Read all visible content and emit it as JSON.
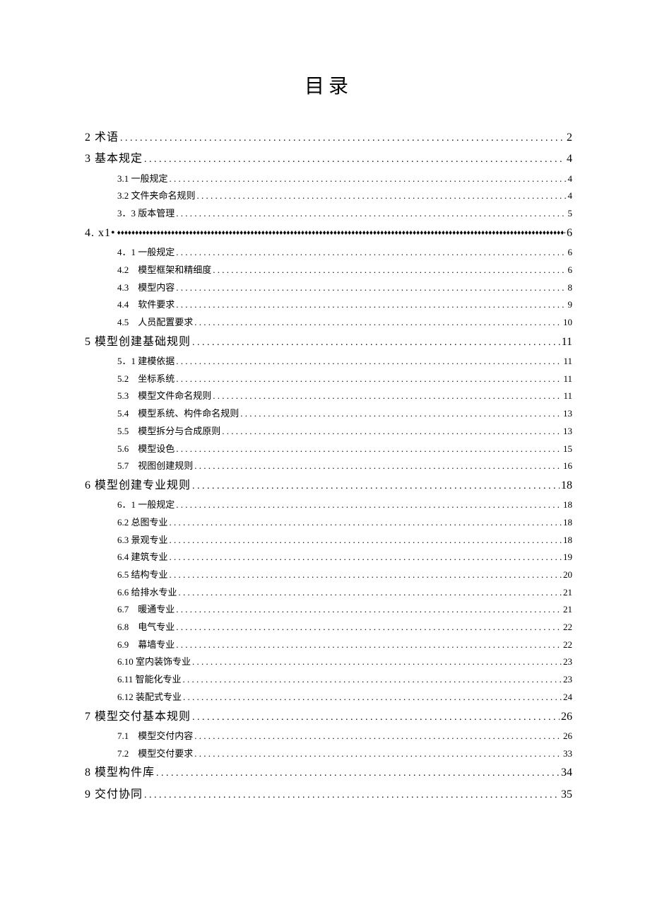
{
  "title": "目录",
  "toc": [
    {
      "level": 1,
      "label": "2 术语",
      "page": "2"
    },
    {
      "level": 1,
      "label": "3 基本规定",
      "page": "4"
    },
    {
      "level": 2,
      "label": "3.1 一般规定",
      "page": "4"
    },
    {
      "level": 2,
      "label": "3.2 文件夹命名规则",
      "page": "4"
    },
    {
      "level": 2,
      "label": "3．3 版本管理",
      "page": "5"
    },
    {
      "level": 1,
      "label": "4. x1•",
      "page": "6",
      "leader": "diamond"
    },
    {
      "level": 2,
      "label": "4．1 一般规定",
      "page": "6"
    },
    {
      "level": 2,
      "label": "4.2　模型框架和精细度",
      "page": "6"
    },
    {
      "level": 2,
      "label": "4.3　模型内容",
      "page": "8"
    },
    {
      "level": 2,
      "label": "4.4　软件要求",
      "page": "9"
    },
    {
      "level": 2,
      "label": "4.5　人员配置要求",
      "page": "10"
    },
    {
      "level": 1,
      "label": "5 模型创建基础规则",
      "page": "11"
    },
    {
      "level": 2,
      "label": "5．1 建模依据",
      "page": "11"
    },
    {
      "level": 2,
      "label": "5.2　坐标系统",
      "page": "11"
    },
    {
      "level": 2,
      "label": "5.3　模型文件命名规则",
      "page": "11"
    },
    {
      "level": 2,
      "label": "5.4　模型系统、构件命名规则",
      "page": "13"
    },
    {
      "level": 2,
      "label": "5.5　模型拆分与合成原则",
      "page": "13"
    },
    {
      "level": 2,
      "label": "5.6　模型设色",
      "page": "15"
    },
    {
      "level": 2,
      "label": "5.7　视图创建规则",
      "page": "16"
    },
    {
      "level": 1,
      "label": "6 模型创建专业规则",
      "page": "18"
    },
    {
      "level": 2,
      "label": "6．1 一般规定",
      "page": "18"
    },
    {
      "level": 2,
      "label": "6.2 总图专业",
      "page": "18"
    },
    {
      "level": 2,
      "label": "6.3 景观专业",
      "page": "18"
    },
    {
      "level": 2,
      "label": "6.4 建筑专业",
      "page": "19"
    },
    {
      "level": 2,
      "label": "6.5 结构专业",
      "page": "20"
    },
    {
      "level": 2,
      "label": "6.6 给排水专业",
      "page": "21"
    },
    {
      "level": 2,
      "label": "6.7　暖通专业",
      "page": "21"
    },
    {
      "level": 2,
      "label": "6.8　电气专业",
      "page": "22"
    },
    {
      "level": 2,
      "label": "6.9　幕墙专业",
      "page": "22"
    },
    {
      "level": 2,
      "label": "6.10 室内装饰专业",
      "page": "23"
    },
    {
      "level": 2,
      "label": "6.11 智能化专业",
      "page": "23"
    },
    {
      "level": 2,
      "label": "6.12 装配式专业",
      "page": "24"
    },
    {
      "level": 1,
      "label": "7 模型交付基本规则",
      "page": "26"
    },
    {
      "level": 2,
      "label": "7.1　模型交付内容",
      "page": "26"
    },
    {
      "level": 2,
      "label": "7.2　模型交付要求",
      "page": "33"
    },
    {
      "level": 1,
      "label": "8 模型构件库",
      "page": "34"
    },
    {
      "level": 1,
      "label": "9 交付协同",
      "page": "35"
    }
  ]
}
